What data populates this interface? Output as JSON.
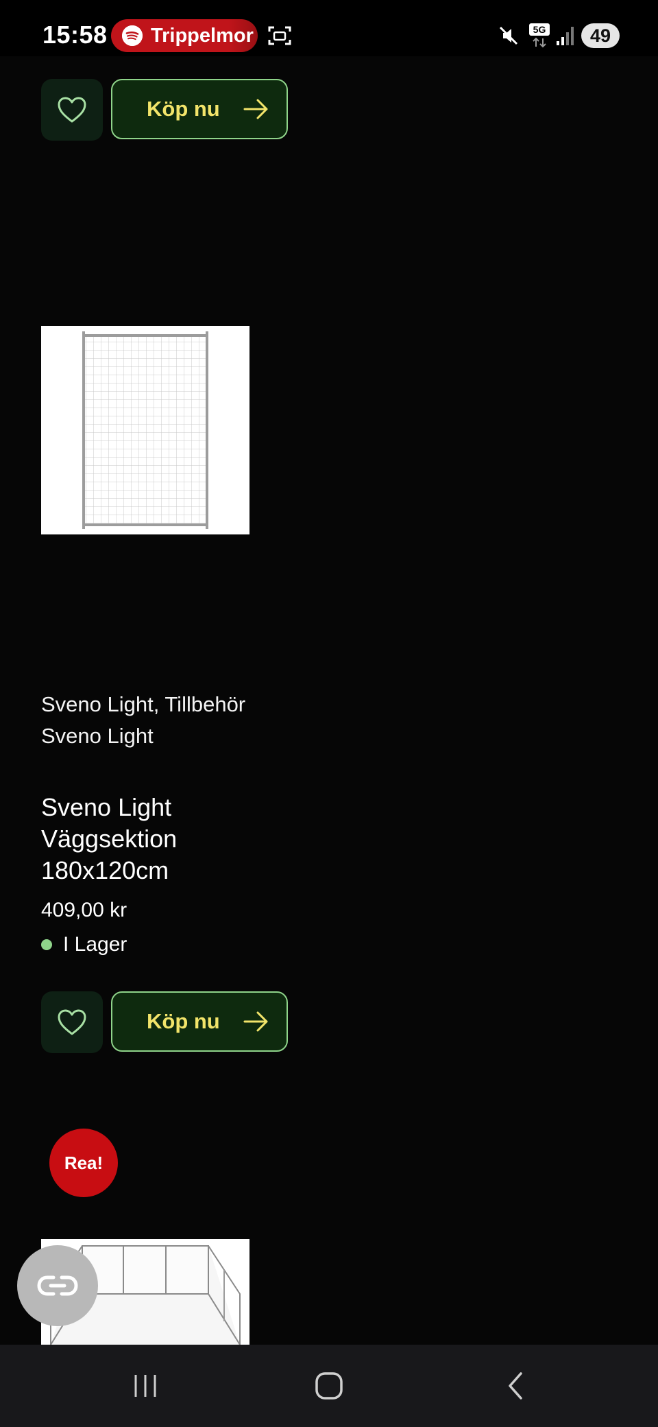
{
  "status_bar": {
    "time": "15:58",
    "media_title": "Trippelmor",
    "network": "5G",
    "battery": "49",
    "icons": [
      "spotify-icon",
      "screen-capture-icon",
      "mute-icon",
      "network-5g-icon",
      "signal-icon"
    ]
  },
  "top_card": {
    "buy_label": "Köp nu"
  },
  "product": {
    "categories": "Sveno Light, Tillbehör Sveno Light",
    "name": "Sveno Light Väggsektion 180x120cm",
    "price": "409,00 kr",
    "stock": "I Lager",
    "buy_label": "Köp nu"
  },
  "next_product": {
    "badge": "Rea!"
  },
  "colors": {
    "background": "#060606",
    "buy_text": "#f2e46a",
    "buy_border": "#8fd48a",
    "stock_dot": "#8fd48a",
    "sale_badge": "#c80d12"
  }
}
